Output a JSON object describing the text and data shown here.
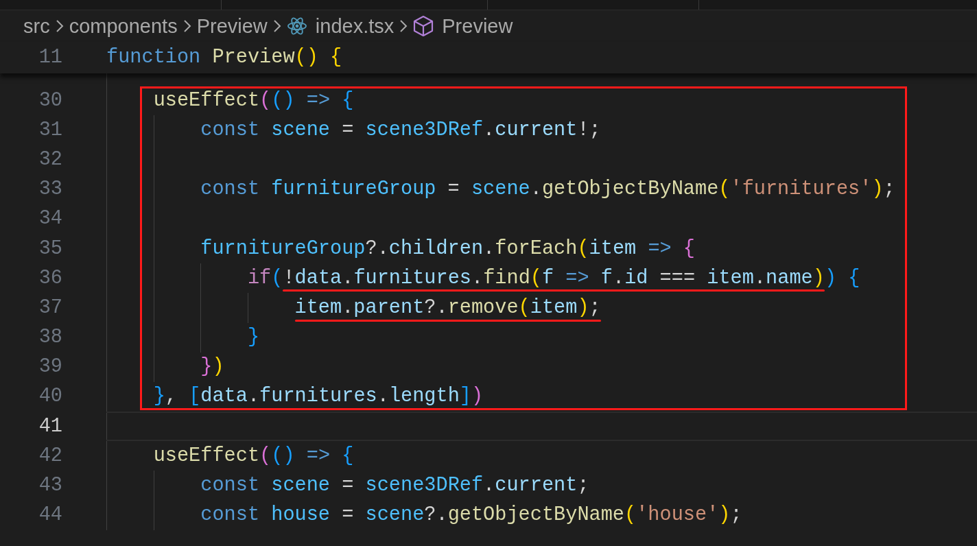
{
  "breadcrumb": [
    {
      "label": "src",
      "kind": "folder"
    },
    {
      "label": "components",
      "kind": "folder"
    },
    {
      "label": "Preview",
      "kind": "folder"
    },
    {
      "label": "index.tsx",
      "kind": "file"
    },
    {
      "label": "Preview",
      "kind": "symbol"
    }
  ],
  "sticky_line": {
    "number": "11",
    "tokens": [
      {
        "text": "function",
        "kind": "kw"
      },
      {
        "text": " Preview",
        "kind": "fn"
      },
      {
        "text": "()",
        "kind": "b1"
      },
      {
        "text": " {",
        "kind": "b1"
      }
    ]
  },
  "blocks": [
    {
      "boxed": true,
      "lines": [
        {
          "number": "30",
          "current": false,
          "tokens": [
            {
              "text": "useEffect",
              "kind": "fn"
            },
            {
              "text": "(",
              "kind": "b2"
            },
            {
              "text": "()",
              "kind": "b3"
            },
            {
              "text": " =>",
              "kind": "kw"
            },
            {
              "text": " {",
              "kind": "b3"
            }
          ],
          "children": [
            {
              "number": "31",
              "current": false,
              "tokens": [
                {
                  "text": "const",
                  "kind": "kw"
                },
                {
                  "text": " scene",
                  "kind": "const"
                },
                {
                  "text": " = ",
                  "kind": "op"
                },
                {
                  "text": "scene3DRef",
                  "kind": "const"
                },
                {
                  "text": ".",
                  "kind": "op"
                },
                {
                  "text": "current",
                  "kind": "var"
                },
                {
                  "text": "!;",
                  "kind": "op"
                }
              ]
            },
            {
              "number": "32",
              "current": false
            },
            {
              "number": "33",
              "current": false,
              "tokens": [
                {
                  "text": "const",
                  "kind": "kw"
                },
                {
                  "text": " furnitureGroup",
                  "kind": "const"
                },
                {
                  "text": " = ",
                  "kind": "op"
                },
                {
                  "text": "scene",
                  "kind": "const"
                },
                {
                  "text": ".",
                  "kind": "op"
                },
                {
                  "text": "getObjectByName",
                  "kind": "fn"
                },
                {
                  "text": "(",
                  "kind": "b1"
                },
                {
                  "text": "'furnitures'",
                  "kind": "str"
                },
                {
                  "text": ")",
                  "kind": "b1"
                },
                {
                  "text": ";",
                  "kind": "op"
                }
              ]
            },
            {
              "number": "34",
              "current": false
            },
            {
              "number": "35",
              "current": false,
              "tokens": [
                {
                  "text": "furnitureGroup",
                  "kind": "const"
                },
                {
                  "text": "?.",
                  "kind": "op"
                },
                {
                  "text": "children",
                  "kind": "var"
                },
                {
                  "text": ".",
                  "kind": "op"
                },
                {
                  "text": "forEach",
                  "kind": "fn"
                },
                {
                  "text": "(",
                  "kind": "b1"
                },
                {
                  "text": "item",
                  "kind": "var"
                },
                {
                  "text": " =>",
                  "kind": "kw"
                },
                {
                  "text": " {",
                  "kind": "b2"
                }
              ],
              "children": [
                {
                  "number": "36",
                  "current": false,
                  "tokens": [
                    {
                      "text": "if",
                      "kind": "ctrl",
                      "underlined": false
                    },
                    {
                      "text": "(",
                      "kind": "b3",
                      "underlined": false
                    },
                    {
                      "text": "!",
                      "kind": "op",
                      "underlined": true
                    },
                    {
                      "text": "data",
                      "kind": "var",
                      "underlined": true
                    },
                    {
                      "text": ".",
                      "kind": "op",
                      "underlined": true
                    },
                    {
                      "text": "furnitures",
                      "kind": "var",
                      "underlined": true
                    },
                    {
                      "text": ".",
                      "kind": "op",
                      "underlined": true
                    },
                    {
                      "text": "find",
                      "kind": "fn",
                      "underlined": true
                    },
                    {
                      "text": "(",
                      "kind": "b1",
                      "underlined": true
                    },
                    {
                      "text": "f",
                      "kind": "var",
                      "underlined": true
                    },
                    {
                      "text": " =>",
                      "kind": "kw",
                      "underlined": true
                    },
                    {
                      "text": " f",
                      "kind": "var",
                      "underlined": true
                    },
                    {
                      "text": ".",
                      "kind": "op",
                      "underlined": true
                    },
                    {
                      "text": "id",
                      "kind": "var",
                      "underlined": true
                    },
                    {
                      "text": " === ",
                      "kind": "op",
                      "underlined": true
                    },
                    {
                      "text": "item",
                      "kind": "var",
                      "underlined": true
                    },
                    {
                      "text": ".",
                      "kind": "op",
                      "underlined": true
                    },
                    {
                      "text": "name",
                      "kind": "var",
                      "underlined": true
                    },
                    {
                      "text": ")",
                      "kind": "b1",
                      "underlined": true
                    },
                    {
                      "text": ")",
                      "kind": "b3",
                      "underlined": false
                    },
                    {
                      "text": " {",
                      "kind": "b3",
                      "underlined": false
                    }
                  ],
                  "children": [
                    {
                      "number": "37",
                      "current": false,
                      "tokens": [
                        {
                          "text": "item",
                          "kind": "var",
                          "underlined": true
                        },
                        {
                          "text": ".",
                          "kind": "op",
                          "underlined": true
                        },
                        {
                          "text": "parent",
                          "kind": "var",
                          "underlined": true
                        },
                        {
                          "text": "?.",
                          "kind": "op",
                          "underlined": true
                        },
                        {
                          "text": "remove",
                          "kind": "fn",
                          "underlined": true
                        },
                        {
                          "text": "(",
                          "kind": "b1",
                          "underlined": true
                        },
                        {
                          "text": "item",
                          "kind": "var",
                          "underlined": true
                        },
                        {
                          "text": ")",
                          "kind": "b1",
                          "underlined": true
                        },
                        {
                          "text": ";",
                          "kind": "op",
                          "underlined": true
                        }
                      ]
                    }
                  ]
                },
                {
                  "number": "38",
                  "current": false,
                  "tokens": [
                    {
                      "text": "}",
                      "kind": "b3"
                    }
                  ]
                }
              ]
            },
            {
              "number": "39",
              "current": false,
              "tokens": [
                {
                  "text": "}",
                  "kind": "b2"
                },
                {
                  "text": ")",
                  "kind": "b1"
                }
              ]
            }
          ]
        },
        {
          "number": "40",
          "current": false,
          "tokens": [
            {
              "text": "}",
              "kind": "b3"
            },
            {
              "text": ", ",
              "kind": "op"
            },
            {
              "text": "[",
              "kind": "b3"
            },
            {
              "text": "data",
              "kind": "var"
            },
            {
              "text": ".",
              "kind": "op"
            },
            {
              "text": "furnitures",
              "kind": "var"
            },
            {
              "text": ".",
              "kind": "op"
            },
            {
              "text": "length",
              "kind": "var"
            },
            {
              "text": "]",
              "kind": "b3"
            },
            {
              "text": ")",
              "kind": "b2"
            }
          ]
        }
      ]
    },
    {
      "boxed": false,
      "lines": [
        {
          "number": "41",
          "current": true
        },
        {
          "number": "42",
          "current": false,
          "tokens": [
            {
              "text": "useEffect",
              "kind": "fn"
            },
            {
              "text": "(",
              "kind": "b2"
            },
            {
              "text": "()",
              "kind": "b3"
            },
            {
              "text": " =>",
              "kind": "kw"
            },
            {
              "text": " {",
              "kind": "b3"
            }
          ],
          "children": [
            {
              "number": "43",
              "current": false,
              "tokens": [
                {
                  "text": "const",
                  "kind": "kw"
                },
                {
                  "text": " scene",
                  "kind": "const"
                },
                {
                  "text": " = ",
                  "kind": "op"
                },
                {
                  "text": "scene3DRef",
                  "kind": "const"
                },
                {
                  "text": ".",
                  "kind": "op"
                },
                {
                  "text": "current",
                  "kind": "var"
                },
                {
                  "text": ";",
                  "kind": "op"
                }
              ]
            },
            {
              "number": "44",
              "current": false,
              "tokens": [
                {
                  "text": "const",
                  "kind": "kw"
                },
                {
                  "text": " house",
                  "kind": "const"
                },
                {
                  "text": " = ",
                  "kind": "op"
                },
                {
                  "text": "scene",
                  "kind": "const"
                },
                {
                  "text": "?.",
                  "kind": "op"
                },
                {
                  "text": "getObjectByName",
                  "kind": "fn"
                },
                {
                  "text": "(",
                  "kind": "b1"
                },
                {
                  "text": "'house'",
                  "kind": "str"
                },
                {
                  "text": ")",
                  "kind": "b1"
                },
                {
                  "text": ";",
                  "kind": "op"
                }
              ]
            }
          ]
        }
      ]
    }
  ]
}
